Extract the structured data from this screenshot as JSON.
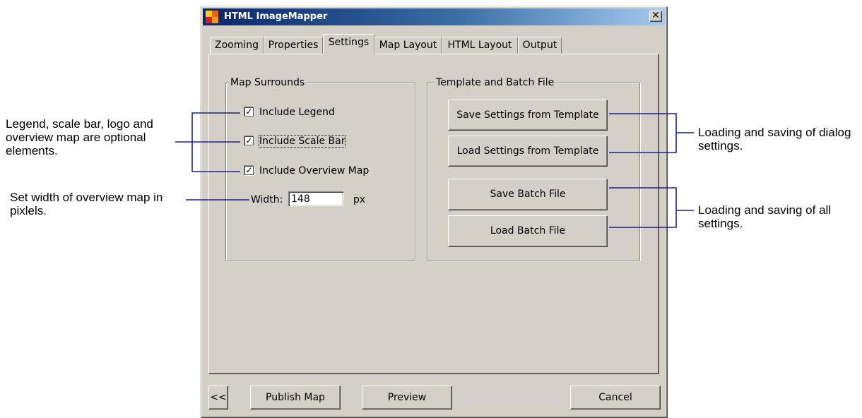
{
  "annotations": {
    "optional_elements": "Legend, scale bar, logo and overview map are optional elements.",
    "overview_width": "Set width of overview map in pixlels.",
    "dialog_settings": "Loading and saving of dialog settings.",
    "all_settings": "Loading and saving of all settings."
  },
  "window": {
    "title": "HTML ImageMapper",
    "close_label": "✕",
    "icon": "imagemapper-app-icon"
  },
  "tabs": [
    {
      "label": "Zooming",
      "active": false
    },
    {
      "label": "Properties",
      "active": false
    },
    {
      "label": "Settings",
      "active": true
    },
    {
      "label": "Map Layout",
      "active": false
    },
    {
      "label": "HTML Layout",
      "active": false
    },
    {
      "label": "Output",
      "active": false
    }
  ],
  "map_surrounds": {
    "legend": "Map Surrounds",
    "include_legend": {
      "label": "Include Legend",
      "checked": true
    },
    "include_scale_bar": {
      "label": "Include Scale Bar",
      "checked": true
    },
    "include_overview_map": {
      "label": "Include Overview Map",
      "checked": true
    },
    "width_label": "Width:",
    "width_value": "148",
    "width_unit": "px"
  },
  "template_batch": {
    "legend": "Template and Batch File",
    "save_settings_label": "Save Settings from Template",
    "load_settings_label": "Load Settings from Template",
    "save_batch_label": "Save Batch File",
    "load_batch_label": "Load Batch File"
  },
  "footer": {
    "back_label": "<<",
    "publish_label": "Publish Map",
    "preview_label": "Preview",
    "cancel_label": "Cancel"
  },
  "colors": {
    "dialog_face": "#d4d0c8",
    "titlebar_start": "#0a246a",
    "titlebar_end": "#a6caf0",
    "leader_line": "#1f1f8a"
  }
}
